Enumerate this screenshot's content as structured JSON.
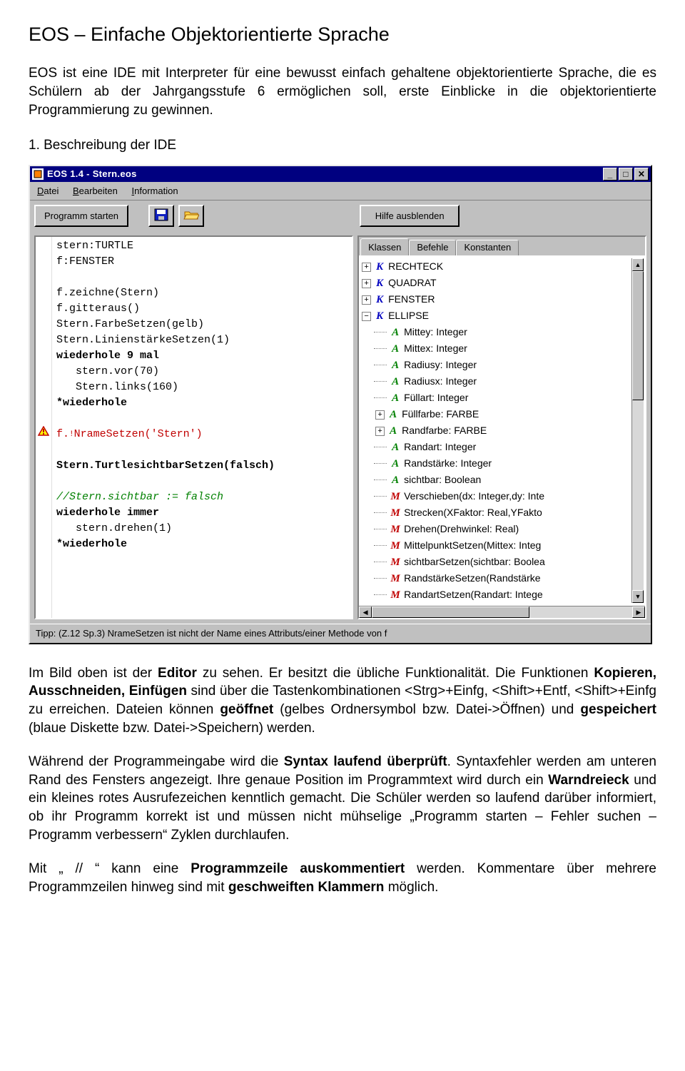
{
  "doc": {
    "title": "EOS – Einfache Objektorientierte Sprache",
    "intro": "EOS ist eine IDE mit Interpreter für eine bewusst einfach gehaltene objektorientierte Sprache, die es Schülern ab der Jahrgangsstufe 6 ermöglichen soll, erste Einblicke in die objektorientierte Programmierung zu gewinnen.",
    "section1": "1. Beschreibung der IDE",
    "p1a": "Im Bild oben ist der ",
    "p1b": "Editor",
    "p1c": " zu sehen. Er besitzt die übliche Funktionalität. Die Funktionen ",
    "p1d": "Kopieren, Ausschneiden, Einfügen",
    "p1e": " sind über die Tastenkombinationen <Strg>+Einfg, <Shift>+Entf, <Shift>+Einfg zu erreichen. Dateien können ",
    "p1f": "geöffnet",
    "p1g": " (gelbes Ordnersymbol bzw. Datei->Öffnen) und ",
    "p1h": "gespeichert",
    "p1i": " (blaue Diskette bzw. Datei->Speichern) werden.",
    "p2a": "Während der Programmeingabe wird die ",
    "p2b": "Syntax laufend überprüft",
    "p2c": ". Syntaxfehler werden am unteren Rand des Fensters angezeigt. Ihre genaue Position im Programmtext wird durch ein ",
    "p2d": "Warndreieck",
    "p2e": " und ein kleines rotes Ausrufezeichen kenntlich gemacht. Die Schüler werden so laufend darüber informiert, ob ihr Programm korrekt ist und müssen nicht mühselige „Programm starten – Fehler suchen – Programm verbessern“ Zyklen durchlaufen.",
    "p3a": "Mit „ // “ kann eine ",
    "p3b": "Programmzeile auskommentiert",
    "p3c": " werden. Kommentare über mehrere Programmzeilen hinweg sind mit ",
    "p3d": "geschweiften Klammern",
    "p3e": " möglich."
  },
  "ide": {
    "title": "EOS 1.4 - Stern.eos",
    "menus": {
      "m1": "Datei",
      "m2": "Bearbeiten",
      "m3": "Information"
    },
    "toolbar": {
      "run": "Programm starten",
      "help": "Hilfe ausblenden"
    },
    "code_lines": [
      {
        "t": "stern:TURTLE"
      },
      {
        "t": "f:FENSTER"
      },
      {
        "t": ""
      },
      {
        "t": "f.zeichne(Stern)"
      },
      {
        "t": "f.gitteraus()"
      },
      {
        "t": "Stern.FarbeSetzen(gelb)"
      },
      {
        "t": "Stern.LinienstärkeSetzen(1)"
      },
      {
        "t": "wiederhole 9 mal",
        "cls": "kw"
      },
      {
        "t": "   stern.vor(70)"
      },
      {
        "t": "   Stern.links(160)"
      },
      {
        "t": "*wiederhole",
        "cls": "kw"
      },
      {
        "t": ""
      },
      {
        "t": "f.NrameSetzen('Stern')",
        "cls": "err",
        "warn": true,
        "exc": true
      },
      {
        "t": ""
      },
      {
        "t": "Stern.TurtlesichtbarSetzen(falsch)",
        "cls": "kw"
      },
      {
        "t": ""
      },
      {
        "t": "//Stern.sichtbar := falsch",
        "cls": "cmt"
      },
      {
        "t": "wiederhole immer",
        "cls": "kw"
      },
      {
        "t": "   stern.drehen(1)"
      },
      {
        "t": "*wiederhole",
        "cls": "kw"
      }
    ],
    "tabs": {
      "t1": "Klassen",
      "t2": "Befehle",
      "t3": "Konstanten"
    },
    "tree": [
      {
        "depth": 0,
        "exp": "+",
        "glyph": "K",
        "label": "RECHTECK"
      },
      {
        "depth": 0,
        "exp": "+",
        "glyph": "K",
        "label": "QUADRAT"
      },
      {
        "depth": 0,
        "exp": "+",
        "glyph": "K",
        "label": "FENSTER"
      },
      {
        "depth": 0,
        "exp": "-",
        "glyph": "K",
        "label": "ELLIPSE"
      },
      {
        "depth": 1,
        "exp": "",
        "glyph": "A",
        "label": "Mittey: Integer"
      },
      {
        "depth": 1,
        "exp": "",
        "glyph": "A",
        "label": "Mittex: Integer"
      },
      {
        "depth": 1,
        "exp": "",
        "glyph": "A",
        "label": "Radiusy: Integer"
      },
      {
        "depth": 1,
        "exp": "",
        "glyph": "A",
        "label": "Radiusx: Integer"
      },
      {
        "depth": 1,
        "exp": "",
        "glyph": "A",
        "label": "Füllart: Integer"
      },
      {
        "depth": 1,
        "exp": "+",
        "glyph": "A",
        "label": "Füllfarbe: FARBE"
      },
      {
        "depth": 1,
        "exp": "+",
        "glyph": "A",
        "label": "Randfarbe: FARBE"
      },
      {
        "depth": 1,
        "exp": "",
        "glyph": "A",
        "label": "Randart: Integer"
      },
      {
        "depth": 1,
        "exp": "",
        "glyph": "A",
        "label": "Randstärke: Integer"
      },
      {
        "depth": 1,
        "exp": "",
        "glyph": "A",
        "label": "sichtbar: Boolean"
      },
      {
        "depth": 1,
        "exp": "",
        "glyph": "M",
        "label": "Verschieben(dx: Integer,dy: Inte"
      },
      {
        "depth": 1,
        "exp": "",
        "glyph": "M",
        "label": "Strecken(XFaktor: Real,YFakto"
      },
      {
        "depth": 1,
        "exp": "",
        "glyph": "M",
        "label": "Drehen(Drehwinkel: Real)"
      },
      {
        "depth": 1,
        "exp": "",
        "glyph": "M",
        "label": "MittelpunktSetzen(Mittex: Integ"
      },
      {
        "depth": 1,
        "exp": "",
        "glyph": "M",
        "label": "sichtbarSetzen(sichtbar: Boolea"
      },
      {
        "depth": 1,
        "exp": "",
        "glyph": "M",
        "label": "RandstärkeSetzen(Randstärke"
      },
      {
        "depth": 1,
        "exp": "",
        "glyph": "M",
        "label": "RandartSetzen(Randart: Intege"
      }
    ],
    "status": "Tipp: (Z.12 Sp.3)   NrameSetzen ist nicht der Name eines Attributs/einer Methode von f"
  }
}
